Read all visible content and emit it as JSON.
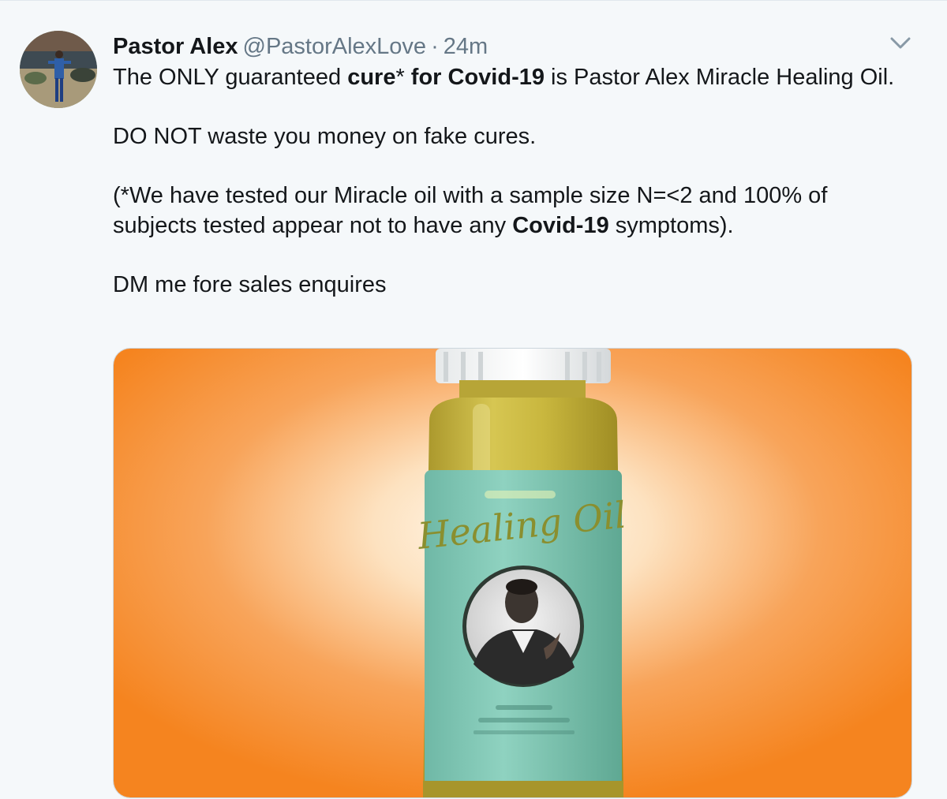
{
  "tweet": {
    "author": {
      "display_name": "Pastor Alex",
      "handle": "@PastorAlexLove"
    },
    "separator": "·",
    "time": "24m",
    "more_icon": "chevron-down-icon",
    "text": {
      "p1": {
        "a": "The ONLY guaranteed ",
        "b_bold": "cure",
        "c": "* ",
        "d_bold": "for Covid-19",
        "e": " is Pastor Alex Miracle Healing Oil."
      },
      "p2": "DO NOT waste you money on fake cures.",
      "p3": {
        "a": "(*We have tested our Miracle oil with a sample size N=<2 and 100% of subjects tested appear not to have any ",
        "b_bold": "Covid-19",
        "c": " symptoms)."
      },
      "p4": "DM me fore sales enquires"
    },
    "media": {
      "label_text": "Healing Oil",
      "colors": {
        "background": "#f5841f",
        "label": "#7fc7b6",
        "oil": "#c7b53a"
      }
    }
  },
  "colors": {
    "text": "#14171a",
    "secondary": "#657786",
    "page_background": "#f5f8fa"
  }
}
